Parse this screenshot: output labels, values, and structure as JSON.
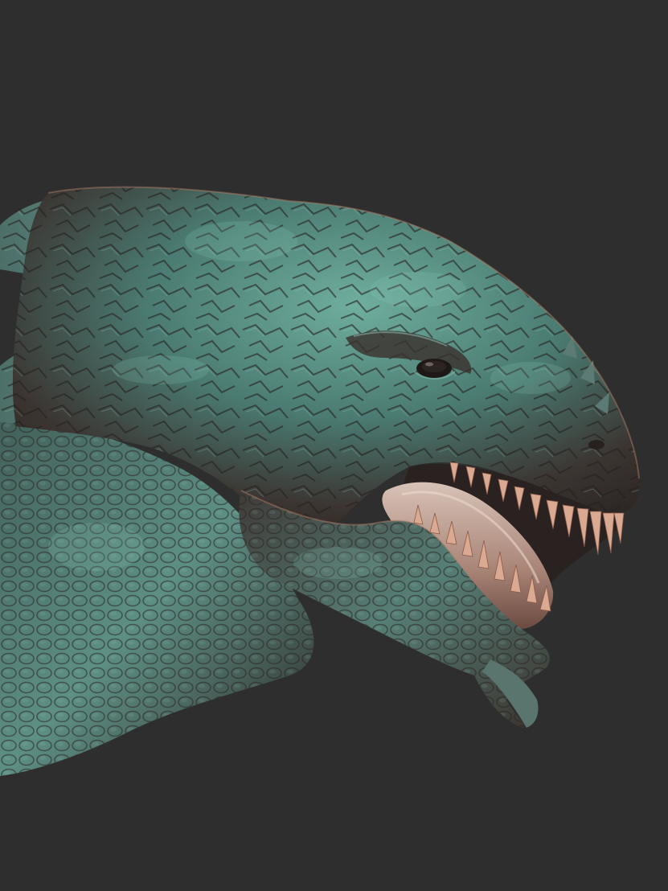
{
  "scene": {
    "subject": "creature-head-sculpt",
    "colors": {
      "background": "#2e2e2e",
      "skin_dark": "#3a3330",
      "skin_mid": "#5a4a42",
      "skin_teal": "#4f8f84",
      "skin_teal_light": "#78b8a9",
      "copper": "#b9826b",
      "tongue": "#c8a79a",
      "teeth": "#e0b49e"
    }
  }
}
